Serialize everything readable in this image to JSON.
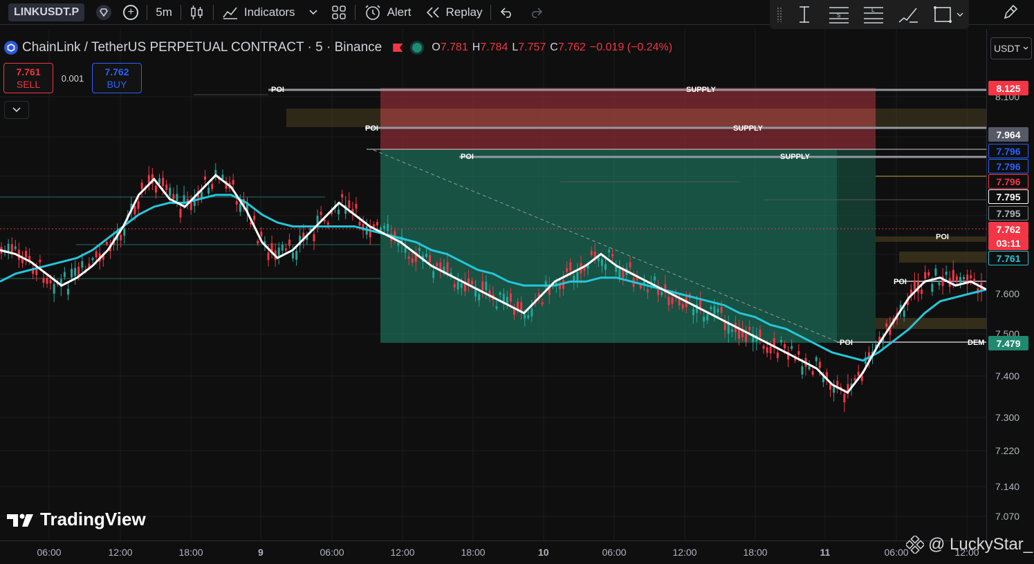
{
  "toolbar": {
    "symbol": "LINKUSDT.P",
    "interval": "5m",
    "indicators_label": "Indicators",
    "alert_label": "Alert",
    "replay_label": "Replay"
  },
  "legend": {
    "title": "ChainLink / TetherUS PERPETUAL CONTRACT · 5 · Binance",
    "open_key": "O",
    "open": "7.781",
    "high_key": "H",
    "high": "7.784",
    "low_key": "L",
    "low": "7.757",
    "close_key": "C",
    "close": "7.762",
    "change": "−0.019 (−0.24%)"
  },
  "trade": {
    "sell_price": "7.761",
    "sell_label": "SELL",
    "spread": "0.001",
    "buy_price": "7.762",
    "buy_label": "BUY"
  },
  "currency_label": "USDT",
  "watermark": "TradingView",
  "credit": "@ LuckyStar_",
  "colors": {
    "up": "#26a69a",
    "down": "#f23645",
    "ema_fast": "#ffffff",
    "ema_slow": "#26c6da",
    "supply_zone": "#8b2c35",
    "demand_zone": "#1f8a70"
  },
  "price_axis": {
    "ticks": [
      "8.100",
      "7.600",
      "7.500",
      "7.400",
      "7.300",
      "7.220",
      "7.140",
      "7.070"
    ],
    "tags": [
      {
        "text": "8.125",
        "bg": "#f23645",
        "fg": "#ffffff",
        "border": "#f23645"
      },
      {
        "text": "7.964",
        "bg": "#555a66",
        "fg": "#ffffff",
        "border": "#555a66"
      },
      {
        "text": "7.796",
        "bg": "#0f0f0f",
        "fg": "#2962ff",
        "border": "#2962ff"
      },
      {
        "text": "7.796",
        "bg": "#0f0f0f",
        "fg": "#2962ff",
        "border": "#2962ff"
      },
      {
        "text": "7.796",
        "bg": "#0f0f0f",
        "fg": "#f23645",
        "border": "#f23645"
      },
      {
        "text": "7.795",
        "bg": "#0f0f0f",
        "fg": "#ffffff",
        "border": "#ffffff"
      },
      {
        "text": "7.795",
        "bg": "#0f0f0f",
        "fg": "#b2b5be",
        "border": "#7b7f8a"
      },
      {
        "text": "7.762",
        "bg": "#f23645",
        "fg": "#ffffff",
        "border": "#f23645"
      },
      {
        "text": "03:11",
        "bg": "#f23645",
        "fg": "#ffffff",
        "border": "#f23645"
      },
      {
        "text": "7.761",
        "bg": "#0f0f0f",
        "fg": "#26c6da",
        "border": "#26c6da"
      },
      {
        "text": "7.479",
        "bg": "#1f8a70",
        "fg": "#ffffff",
        "border": "#1f8a70"
      }
    ]
  },
  "time_axis": {
    "ticks": [
      "06:00",
      "12:00",
      "18:00",
      "9",
      "06:00",
      "12:00",
      "18:00",
      "10",
      "06:00",
      "12:00",
      "18:00",
      "11",
      "06:00",
      "12:00"
    ]
  },
  "zone_labels": {
    "supply": "SUPPLY",
    "poi": "POI",
    "demand": "DEM"
  },
  "chart_data": {
    "type": "line",
    "series": [
      {
        "values": [
          7.86,
          7.85,
          7.83,
          7.8,
          7.77,
          7.79,
          7.82,
          7.86,
          7.92,
          8.0,
          8.04,
          7.99,
          7.97,
          8.01,
          8.05,
          8.02,
          7.96,
          7.88,
          7.84,
          7.86,
          7.9,
          7.94,
          7.98,
          7.95,
          7.92,
          7.9,
          7.88,
          7.85,
          7.82,
          7.8,
          7.78,
          7.76,
          7.74,
          7.72,
          7.7,
          7.74,
          7.78,
          7.8,
          7.82,
          7.85,
          7.82,
          7.8,
          7.78,
          7.76,
          7.74,
          7.72,
          7.7,
          7.68,
          7.66,
          7.64,
          7.62,
          7.6,
          7.58,
          7.56,
          7.52,
          7.5,
          7.55,
          7.62,
          7.68,
          7.74,
          7.78,
          7.79,
          7.77,
          7.78,
          7.76
        ]
      },
      {
        "values": [
          7.78,
          7.8,
          7.81,
          7.82,
          7.83,
          7.84,
          7.86,
          7.89,
          7.92,
          7.95,
          7.97,
          7.98,
          7.98,
          7.99,
          8.0,
          8.0,
          7.98,
          7.95,
          7.93,
          7.92,
          7.92,
          7.92,
          7.92,
          7.92,
          7.91,
          7.9,
          7.89,
          7.88,
          7.86,
          7.85,
          7.83,
          7.81,
          7.8,
          7.78,
          7.77,
          7.77,
          7.77,
          7.78,
          7.78,
          7.79,
          7.79,
          7.78,
          7.77,
          7.76,
          7.75,
          7.74,
          7.73,
          7.72,
          7.7,
          7.69,
          7.67,
          7.66,
          7.64,
          7.62,
          7.6,
          7.59,
          7.58,
          7.6,
          7.63,
          7.66,
          7.7,
          7.73,
          7.74,
          7.75,
          7.76
        ]
      }
    ],
    "ylim": [
      7.04,
      8.14
    ]
  }
}
